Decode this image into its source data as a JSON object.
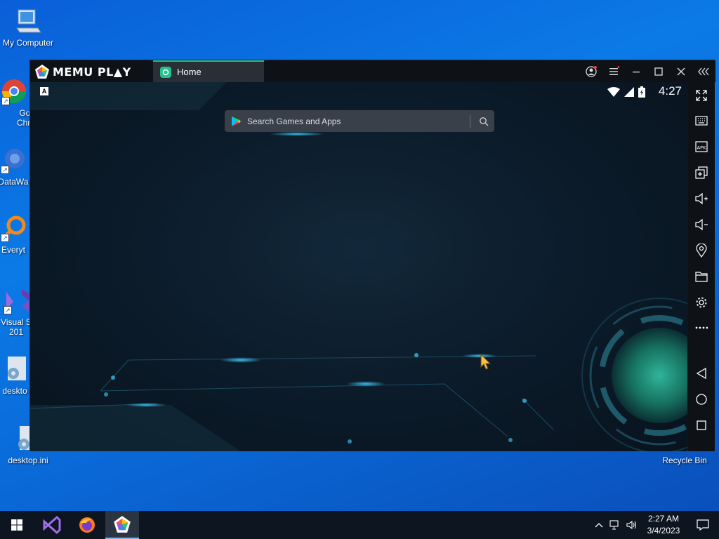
{
  "desktop": {
    "icons": [
      {
        "label": "My Computer",
        "name": "my-computer-icon"
      },
      {
        "label": "Goo\nChro",
        "name": "chrome-icon"
      },
      {
        "label": "DataWa",
        "name": "datawarrior-icon"
      },
      {
        "label": "Everyt",
        "name": "everything-icon"
      },
      {
        "label": "Visual S\n201",
        "name": "visual-studio-icon"
      },
      {
        "label": "deskto",
        "name": "desktop-ini-icon"
      },
      {
        "label": "desktop.ini",
        "name": "desktop-ini-icon"
      },
      {
        "label": "Recycle Bin",
        "name": "recycle-bin-icon"
      }
    ]
  },
  "emulator": {
    "logo_text": "MEMU PL▲Y",
    "tab_label": "Home",
    "accent_color": "#1fbf9a",
    "status_time": "4:27",
    "keyboard_badge": "A",
    "search_placeholder": "Search Games and Apps",
    "toolbar": [
      "fullscreen-icon",
      "keyboard-icon",
      "apk-icon",
      "multi-instance-icon",
      "volume-up-icon",
      "volume-down-icon",
      "location-icon",
      "folder-icon",
      "settings-icon",
      "more-icon",
      "back-icon",
      "home-icon",
      "recents-icon"
    ],
    "apk_label": "APK"
  },
  "taskbar": {
    "time": "2:27 AM",
    "date": "3/4/2023"
  }
}
